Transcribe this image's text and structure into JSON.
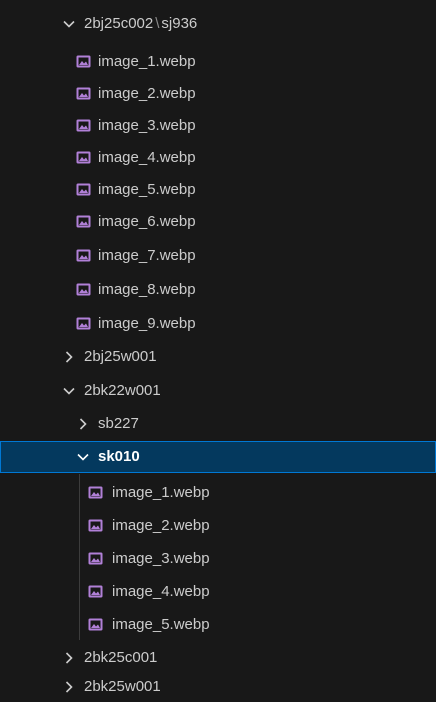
{
  "tree": {
    "folder_2bj25c002": {
      "name_a": "2bj25c002",
      "separator": "\\",
      "name_b": "sj936",
      "files": [
        "image_1.webp",
        "image_2.webp",
        "image_3.webp",
        "image_4.webp",
        "image_5.webp",
        "image_6.webp",
        "image_7.webp",
        "image_8.webp",
        "image_9.webp"
      ]
    },
    "folder_2bj25w001": {
      "name": "2bj25w001"
    },
    "folder_2bk22w001": {
      "name": "2bk22w001",
      "sub_sb227": {
        "name": "sb227"
      },
      "sub_sk010": {
        "name": "sk010",
        "files": [
          "image_1.webp",
          "image_2.webp",
          "image_3.webp",
          "image_4.webp",
          "image_5.webp"
        ]
      }
    },
    "folder_2bk25c001": {
      "name": "2bk25c001"
    },
    "folder_2bk25w001": {
      "name": "2bk25w001"
    }
  },
  "colors": {
    "background": "#181818",
    "text": "#cccccc",
    "selected_bg": "#04395e",
    "selected_border": "#0078d4",
    "image_icon": "#b180d7",
    "indent_guide": "#3c3c3c"
  }
}
